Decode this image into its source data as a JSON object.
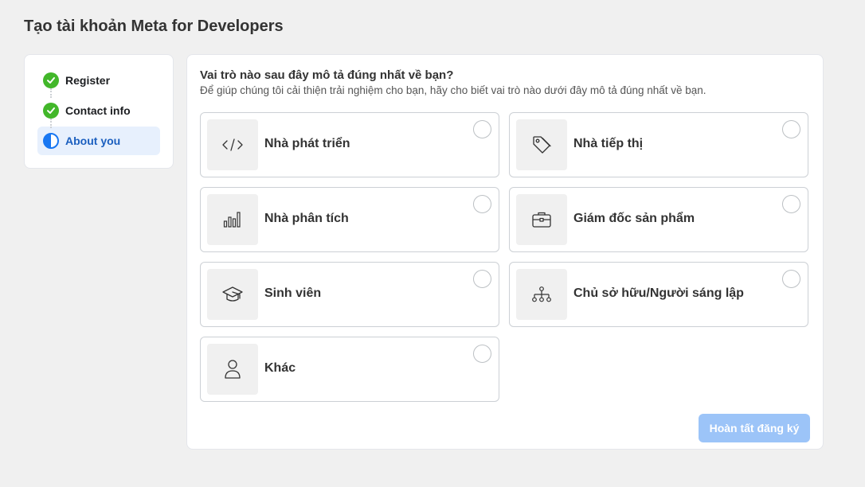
{
  "page": {
    "title": "Tạo tài khoản Meta for Developers"
  },
  "stepper": {
    "steps": [
      {
        "label": "Register",
        "status": "done",
        "icon": "check-icon"
      },
      {
        "label": "Contact info",
        "status": "done",
        "icon": "check-icon"
      },
      {
        "label": "About you",
        "status": "active",
        "icon": "half-circle-icon"
      }
    ]
  },
  "form": {
    "question": "Vai trò nào sau đây mô tả đúng nhất về bạn?",
    "subtitle": "Để giúp chúng tôi cải thiện trải nghiệm cho bạn, hãy cho biết vai trò nào dưới đây mô tả đúng nhất về bạn.",
    "options": [
      {
        "label": "Nhà phát triển",
        "icon": "code-icon"
      },
      {
        "label": "Nhà tiếp thị",
        "icon": "tag-icon"
      },
      {
        "label": "Nhà phân tích",
        "icon": "bar-chart-icon"
      },
      {
        "label": "Giám đốc sản phẩm",
        "icon": "briefcase-icon"
      },
      {
        "label": "Sinh viên",
        "icon": "graduation-cap-icon"
      },
      {
        "label": "Chủ sở hữu/Người sáng lập",
        "icon": "org-chart-icon"
      },
      {
        "label": "Khác",
        "icon": "person-icon"
      }
    ],
    "submit_label": "Hoàn tất đăng ký"
  },
  "colors": {
    "done": "#42b72a",
    "active": "#1877f2",
    "active_bg": "#e7f0fd",
    "submit_disabled": "#9cc4f8"
  }
}
